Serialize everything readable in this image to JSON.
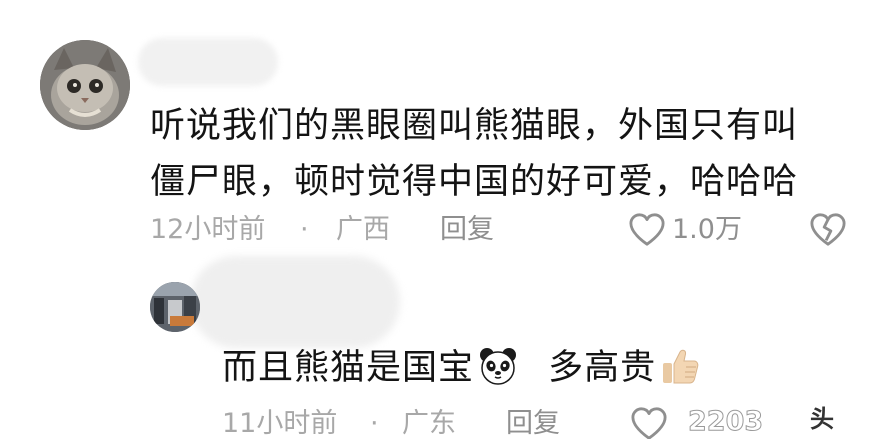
{
  "comments": [
    {
      "text_line1": "听说我们的黑眼圈叫熊猫眼，外国只有叫",
      "text_line2": "僵尸眼，顿时觉得中国的好可爱，哈哈哈",
      "time": "12小时前",
      "dot": "·",
      "location": "广西",
      "reply_label": "回复",
      "like_count": "1.0万"
    },
    {
      "text_part1": "而且熊猫是国宝",
      "text_part2": "多高贵",
      "time": "11小时前",
      "dot": "·",
      "location": "广东",
      "reply_label": "回复"
    }
  ],
  "icons": {
    "like": "heart-outline-icon",
    "dislike": "broken-heart-icon",
    "panda": "panda-emoji",
    "thumb": "thumbs-up-emoji"
  },
  "watermark": {
    "partial_count": "2203",
    "box_text": "头"
  },
  "colors": {
    "text": "#141414",
    "meta": "#a8a8a8",
    "icon": "#8f8f8f"
  }
}
